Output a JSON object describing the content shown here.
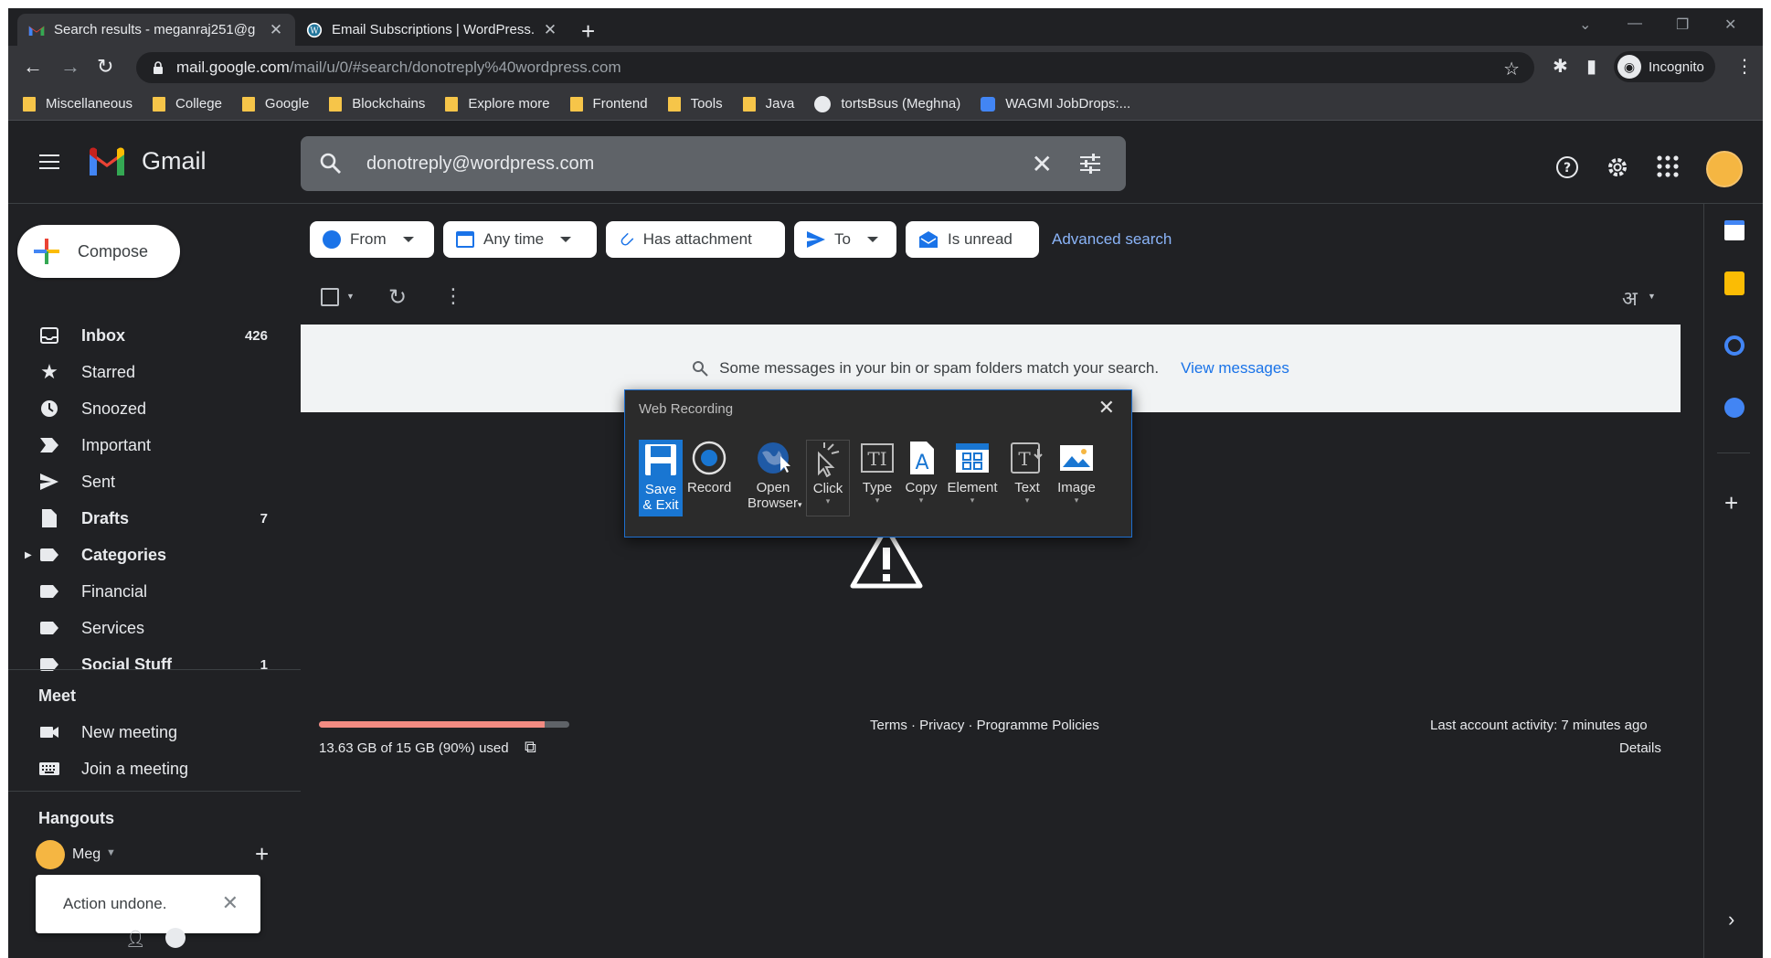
{
  "browser": {
    "tabs": [
      {
        "title": "Search results - meganraj251@g",
        "icon": "gmail-icon",
        "active": true
      },
      {
        "title": "Email Subscriptions | WordPress.c",
        "icon": "wordpress-icon",
        "active": false
      }
    ],
    "url_host": "mail.google.com",
    "url_path": "/mail/u/0/#search/donotreply%40wordpress.com",
    "profile_label": "Incognito",
    "bookmarks": [
      "Miscellaneous",
      "College",
      "Google",
      "Blockchains",
      "Explore more",
      "Frontend",
      "Tools",
      "Java",
      "tortsBsus (Meghna)",
      "WAGMI JobDrops:..."
    ]
  },
  "gmail": {
    "brand": "Gmail",
    "search_query": "donotreply@wordpress.com",
    "compose_label": "Compose",
    "nav": [
      {
        "label": "Inbox",
        "count": "426",
        "icon": "inbox-icon",
        "bold": true
      },
      {
        "label": "Starred",
        "count": "",
        "icon": "star-icon",
        "bold": false
      },
      {
        "label": "Snoozed",
        "count": "",
        "icon": "clock-icon",
        "bold": false
      },
      {
        "label": "Important",
        "count": "",
        "icon": "important-icon",
        "bold": false
      },
      {
        "label": "Sent",
        "count": "",
        "icon": "send-icon",
        "bold": false
      },
      {
        "label": "Drafts",
        "count": "7",
        "icon": "draft-icon",
        "bold": true
      },
      {
        "label": "Categories",
        "count": "",
        "icon": "label-icon",
        "bold": true
      },
      {
        "label": "Financial",
        "count": "",
        "icon": "label-icon",
        "bold": false
      },
      {
        "label": "Services",
        "count": "",
        "icon": "label-icon",
        "bold": false
      },
      {
        "label": "Social Stuff",
        "count": "1",
        "icon": "label-icon",
        "bold": true
      }
    ],
    "meet_title": "Meet",
    "meet_items": [
      "New meeting",
      "Join a meeting"
    ],
    "hangouts_title": "Hangouts",
    "hangouts_user": "Meg",
    "filters": [
      "From",
      "Any time",
      "Has attachment",
      "To",
      "Is unread"
    ],
    "advanced_search": "Advanced search",
    "banner_text": "Some messages in your bin or spam folders match your search.",
    "banner_link": "View messages",
    "input_tool_label": "अ",
    "storage_text": "13.63 GB of 15 GB (90%) used",
    "storage_fraction": 0.9,
    "footer_links": "Terms · Privacy · Programme Policies",
    "last_activity": "Last account activity: 7 minutes ago",
    "details": "Details"
  },
  "web_recording": {
    "title": "Web Recording",
    "buttons": [
      {
        "line1": "Save",
        "line2": "& Exit",
        "icon": "save-icon"
      },
      {
        "line1": "Record",
        "line2": "",
        "icon": "record-icon"
      },
      {
        "line1": "Open",
        "line2": "Browser",
        "icon": "globe-icon"
      },
      {
        "line1": "Click",
        "line2": "",
        "icon": "click-icon"
      },
      {
        "line1": "Type",
        "line2": "",
        "icon": "type-icon"
      },
      {
        "line1": "Copy",
        "line2": "",
        "icon": "copy-icon"
      },
      {
        "line1": "Element",
        "line2": "",
        "icon": "element-icon"
      },
      {
        "line1": "Text",
        "line2": "",
        "icon": "text-icon"
      },
      {
        "line1": "Image",
        "line2": "",
        "icon": "image-icon"
      }
    ]
  },
  "toast": {
    "text": "Action undone."
  }
}
